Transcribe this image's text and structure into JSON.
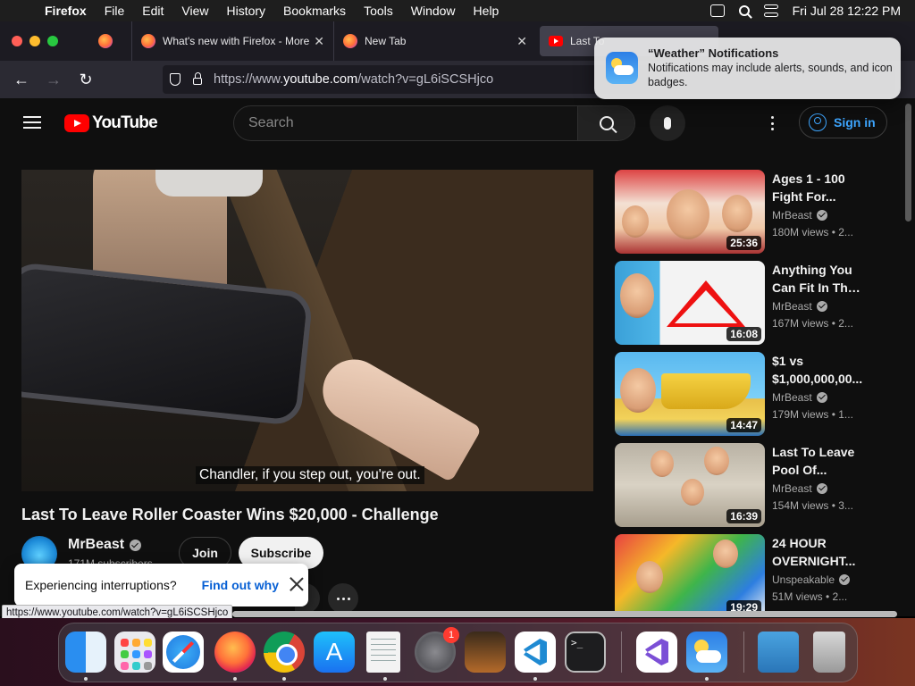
{
  "menubar": {
    "app_name": "Firefox",
    "menus": [
      "File",
      "Edit",
      "View",
      "History",
      "Bookmarks",
      "Tools",
      "Window",
      "Help"
    ],
    "datetime": "Fri Jul 28  12:22 PM"
  },
  "tabs": [
    {
      "title": "",
      "favicon": "firefox-icon"
    },
    {
      "title": "What's new with Firefox - More",
      "favicon": "firefox-icon"
    },
    {
      "title": "New Tab",
      "favicon": "firefox-icon"
    },
    {
      "title": "Last To",
      "favicon": "youtube-icon"
    }
  ],
  "urlbar": {
    "prefix": "https://www.",
    "domain": "youtube.com",
    "path": "/watch?v=gL6iSCSHjco"
  },
  "youtube": {
    "logo_text": "YouTube",
    "search_placeholder": "Search",
    "signin_label": "Sign in",
    "caption": "Chandler, if you step out, you're out.",
    "video_title": "Last To Leave Roller Coaster Wins $20,000 - Challenge",
    "channel_name": "MrBeast",
    "subscribers": "171M subscribers",
    "join_label": "Join",
    "subscribe_label": "Subscribe",
    "toast_text": "Experiencing interruptions?",
    "toast_link": "Find out why"
  },
  "recommendations": [
    {
      "title1": "Ages 1 - 100",
      "title2": "Fight For...",
      "channel": "MrBeast",
      "views": "180M views  • 2...",
      "duration": "25:36"
    },
    {
      "title1": "Anything You",
      "title2": "Can Fit In The...",
      "channel": "MrBeast",
      "views": "167M views  • 2...",
      "duration": "16:08"
    },
    {
      "title1": "$1 vs",
      "title2": "$1,000,000,00...",
      "channel": "MrBeast",
      "views": "179M views  • 1...",
      "duration": "14:47"
    },
    {
      "title1": "Last To Leave",
      "title2": "Pool Of...",
      "channel": "MrBeast",
      "views": "154M views  • 3...",
      "duration": "16:39"
    },
    {
      "title1": "24 HOUR",
      "title2": "OVERNIGHT...",
      "channel": "Unspeakable",
      "views": "51M views  • 2...",
      "duration": "19:29"
    }
  ],
  "status_url": "https://www.youtube.com/watch?v=gL6iSCSHjco",
  "notification": {
    "title": "“Weather” Notifications",
    "body": "Notifications may include alerts, sounds, and icon badges."
  },
  "dock": {
    "settings_badge": "1",
    "terminal_prompt": ">_"
  }
}
